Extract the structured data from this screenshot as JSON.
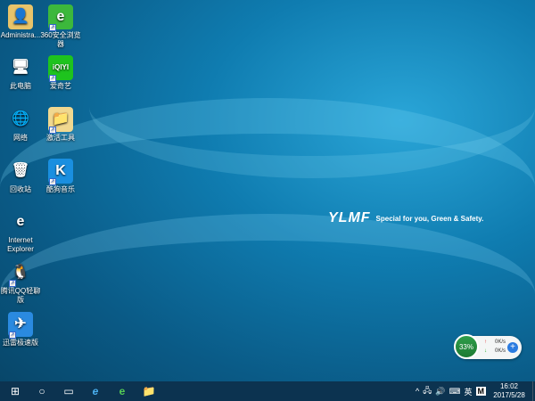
{
  "desktop": {
    "icons": [
      {
        "label": "Administra...",
        "glyph": "👤",
        "bg": "#e8c46a",
        "shortcut": false
      },
      {
        "label": "360安全浏览器",
        "glyph": "e",
        "bg": "#3cb83c",
        "shortcut": true
      },
      {
        "label": "此电脑",
        "glyph": "🖥",
        "bg": "transparent",
        "shortcut": false
      },
      {
        "label": "爱奇艺",
        "glyph": "iQIYI",
        "bg": "#1ec31e",
        "shortcut": true
      },
      {
        "label": "网络",
        "glyph": "🌐",
        "bg": "transparent",
        "shortcut": false
      },
      {
        "label": "激活工具",
        "glyph": "📁",
        "bg": "#f0d890",
        "shortcut": true
      },
      {
        "label": "回收站",
        "glyph": "🗑",
        "bg": "transparent",
        "shortcut": false
      },
      {
        "label": "酷狗音乐",
        "glyph": "K",
        "bg": "#1a8fe0",
        "shortcut": true
      },
      {
        "label": "Internet Explorer",
        "glyph": "e",
        "bg": "transparent",
        "shortcut": false
      },
      {
        "label": "腾讯QQ轻聊版",
        "glyph": "🐧",
        "bg": "transparent",
        "shortcut": true
      },
      {
        "label": "迅雷极速版",
        "glyph": "✈",
        "bg": "#2a8ae0",
        "shortcut": true
      }
    ]
  },
  "wallpaper": {
    "logo": "YLMF",
    "slogan": "Special for you, Green & Safety."
  },
  "widget": {
    "percent": "33%",
    "up": "0K/s",
    "down": "0K/s",
    "up_arrow": "↑",
    "down_arrow": "↓",
    "plus": "+"
  },
  "taskbar": {
    "start": "⊞",
    "search": "○",
    "taskview": "▭",
    "ie": "e",
    "browser360": "e",
    "explorer": "📁"
  },
  "tray": {
    "chevron": "^",
    "network": "🖧",
    "volume": "🔊",
    "keyboard": "⌨",
    "ime": "英",
    "ime2": "M",
    "time": "16:02",
    "date": "2017/5/28"
  }
}
